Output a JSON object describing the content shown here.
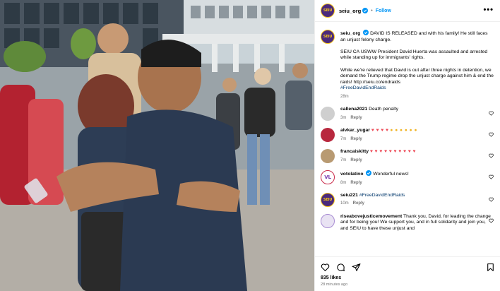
{
  "post": {
    "username": "seiu_org",
    "follow_label": "Follow",
    "more_label": "•••",
    "avatar_text": "SEIU",
    "caption": {
      "lead": "DAVID IS RELEASED and with his family! He still faces an unjust felony charge.",
      "p2": "SEIU CA USWW President David Huerta was assaulted and arrested while standing up for immigrants' rights.",
      "p3": "While we're relieved that David is out after three nights in detention, we demand the Trump regime drop the unjust charge against him & end the raids! http://seiu.co/endraids",
      "hashtag": "#FreeDavidEndRaids",
      "time": "28m"
    },
    "likes": "835 likes",
    "time_ago": "28 minutes ago"
  },
  "comments": [
    {
      "user": "callena2021",
      "text": "Death penalty",
      "time": "3m",
      "reply": "Reply",
      "avatar": "gray",
      "avatar_text": ""
    },
    {
      "user": "alvkar_yugar",
      "text_hearts": "♥ ♥ ♥ ♥",
      "text_claps": "● ● ● ● ● ●",
      "time": "7m",
      "reply": "Reply",
      "avatar": "red",
      "avatar_text": ""
    },
    {
      "user": "francaiskitty",
      "text_hearts": "♥ ♥ ♥ ♥ ♥ ♥ ♥ ♥ ♥ ♥",
      "time": "7m",
      "reply": "Reply",
      "avatar": "tan",
      "avatar_text": ""
    },
    {
      "user": "votolatino",
      "text": "Wonderful news!",
      "time": "8m",
      "reply": "Reply",
      "avatar": "vl",
      "avatar_text": "VL"
    },
    {
      "user": "seiu221",
      "text": "#FreeDavidEndRaids",
      "time": "10m",
      "reply": "Reply",
      "avatar": "seiu",
      "avatar_text": "SEIU"
    },
    {
      "user": "riseabovejusticemovement",
      "text": "Thank you, David, for leading the change and for being you! We support you, and in full solidarity and join you, and SEIU to have these unjust and",
      "time": "",
      "reply": "",
      "avatar": "rise",
      "avatar_text": ""
    }
  ],
  "colors": {
    "accent": "#0095f6",
    "brand_purple": "#4b2a7c",
    "brand_gold": "#f5c518",
    "heart": "#ed4956"
  },
  "icons": [
    "verified-icon",
    "more-icon",
    "heart-icon",
    "comment-icon",
    "share-icon",
    "bookmark-icon"
  ]
}
